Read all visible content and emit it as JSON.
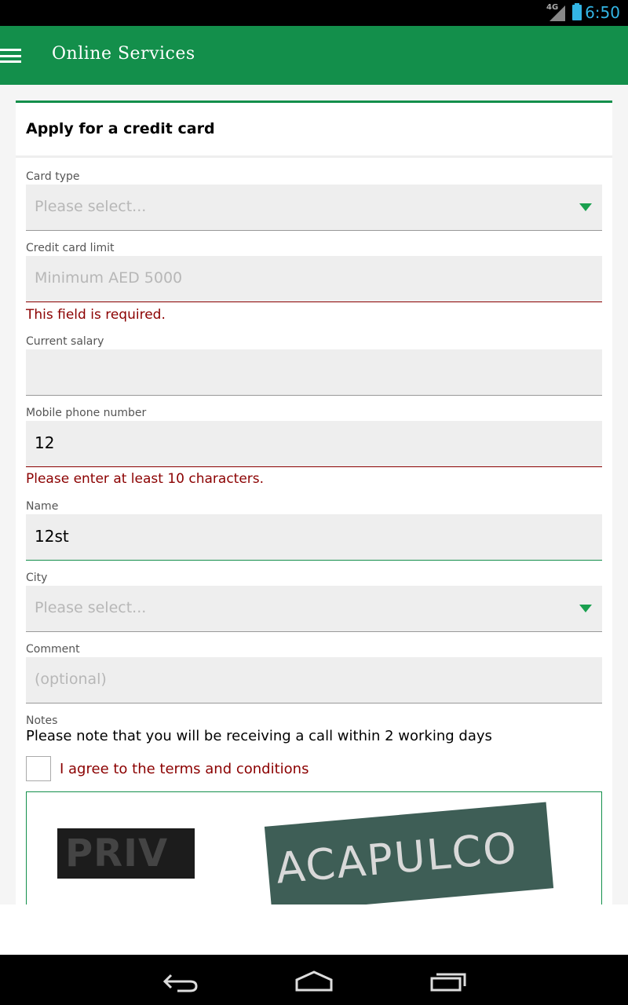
{
  "status_bar": {
    "time": "6:50",
    "network": "4G"
  },
  "app_bar": {
    "title": "Online Services"
  },
  "form": {
    "title": "Apply for a credit card",
    "card_type": {
      "label": "Card type",
      "placeholder": "Please select..."
    },
    "credit_limit": {
      "label": "Credit card limit",
      "placeholder": "Minimum AED 5000",
      "error": "This field is required."
    },
    "salary": {
      "label": "Current salary",
      "value": ""
    },
    "mobile": {
      "label": "Mobile phone number",
      "value": "12",
      "error": "Please enter at least 10 characters."
    },
    "name": {
      "label": "Name",
      "value": "12st"
    },
    "city": {
      "label": "City",
      "placeholder": "Please select..."
    },
    "comment": {
      "label": "Comment",
      "placeholder": "(optional)"
    },
    "notes": {
      "label": "Notes",
      "text": "Please note that you will be receiving a call within 2 working days"
    },
    "terms": {
      "label": "I agree to the terms and conditions",
      "checked": false
    },
    "captcha": {
      "word1": "PRIV",
      "word2": "ACAPULCO"
    }
  },
  "colors": {
    "brand": "#138f4b",
    "error": "#8b0000",
    "status_accent": "#33b5e5"
  }
}
